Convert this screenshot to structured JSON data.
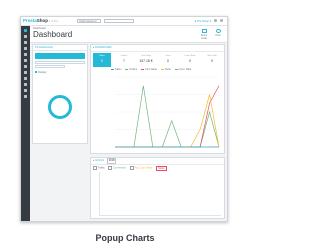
{
  "app": {
    "logo_part1": "Presta",
    "logo_part2": "Shop",
    "version": "1.7.6.x",
    "quick_access": "Quick Access ▾",
    "status_label": "● PS Shop ▾"
  },
  "header": {
    "breadcrumb": "Dashboard",
    "title": "Dashboard",
    "buttons": [
      "Demo mode",
      "Help"
    ]
  },
  "left_panel": {
    "title": "PS Dashactivity",
    "check_label": "Display"
  },
  "chart_panel": {
    "title": "▸ DASHBOARD",
    "kpis": [
      {
        "label": "Sales",
        "value": "0"
      },
      {
        "label": "Orders",
        "value": "7"
      },
      {
        "label": "Cart Value",
        "value": "157.18 €"
      },
      {
        "label": "Visits",
        "value": "0"
      },
      {
        "label": "Conv. Rate",
        "value": "0"
      },
      {
        "label": "Net Profit",
        "value": "0"
      }
    ],
    "legend": [
      {
        "name": "Sales",
        "color": "#2ea2cc"
      },
      {
        "name": "Orders",
        "color": "#70b580"
      },
      {
        "name": "Cart Value",
        "color": "#e84e6a"
      },
      {
        "name": "Visits",
        "color": "#fbbb22"
      },
      {
        "name": "Conv. Rate",
        "color": "#8aa2b2"
      }
    ]
  },
  "bottom_panel": {
    "title": "▸ GOALS",
    "selected": "2018",
    "tabs": [
      "Traffic",
      "Conversion",
      "Avg. Cart Value",
      "Sales"
    ]
  },
  "chart_data": {
    "type": "line",
    "x": [
      1,
      2,
      3,
      4,
      5,
      6,
      7,
      8,
      9,
      10,
      11,
      12
    ],
    "series": [
      {
        "name": "Orders",
        "values": [
          0,
          0,
          0,
          7,
          0,
          0,
          3,
          0,
          0,
          0,
          4,
          0
        ]
      },
      {
        "name": "Cart Value",
        "values": [
          0,
          0,
          0,
          0,
          0,
          0,
          0,
          0,
          0,
          0,
          5,
          7
        ]
      },
      {
        "name": "Visits",
        "values": [
          0,
          0,
          0,
          0,
          0,
          0,
          0,
          0,
          0,
          2,
          6,
          0
        ]
      },
      {
        "name": "Sales",
        "values": [
          0,
          0,
          0,
          0,
          0,
          0,
          0,
          0,
          0,
          0,
          0,
          0
        ]
      }
    ],
    "ylim": [
      0,
      8
    ],
    "colors": [
      "#70b580",
      "#e84e6a",
      "#fbbb22",
      "#2ea2cc"
    ],
    "grid": true
  },
  "caption": "Popup Charts"
}
